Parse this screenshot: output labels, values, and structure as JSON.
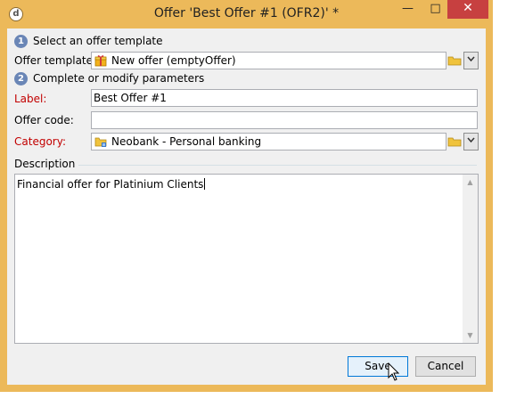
{
  "window": {
    "title": "Offer 'Best Offer #1 (OFR2)' *",
    "app_icon_glyph": "d",
    "min_glyph": "—",
    "max_glyph": "□",
    "close_glyph": "✕"
  },
  "step1": {
    "number": "1",
    "text": "Select an offer template"
  },
  "offer_template": {
    "label": "Offer template:",
    "value": "New offer (emptyOffer)",
    "icon": "offer-template-icon"
  },
  "step2": {
    "number": "2",
    "text": "Complete or modify parameters"
  },
  "label_field": {
    "label": "Label:",
    "value": "Best Offer #1"
  },
  "offer_code": {
    "label": "Offer code:",
    "value": ""
  },
  "category": {
    "label": "Category:",
    "value": "Neobank - Personal banking",
    "icon": "category-folder-icon"
  },
  "description": {
    "legend": "Description",
    "value": "Financial offer for Platinium Clients"
  },
  "buttons": {
    "save": "Save",
    "cancel": "Cancel"
  },
  "dropdown_glyph": "⌵",
  "scroll": {
    "up": "▲",
    "down": "▼"
  },
  "colors": {
    "title_bar": "#ecb95a",
    "close_button": "#c74040",
    "required_label": "#c20000",
    "step_badge": "#6a86b6"
  }
}
